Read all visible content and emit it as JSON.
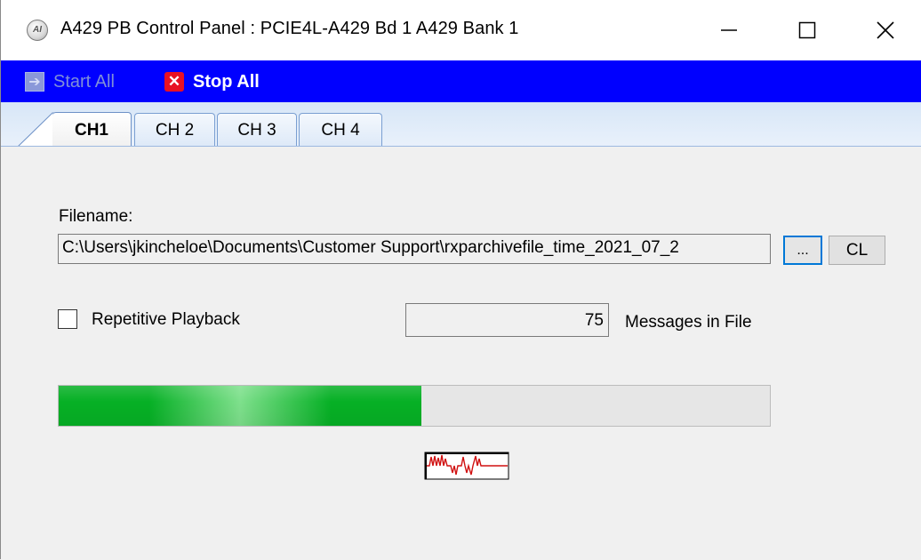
{
  "window": {
    "title": "A429 PB Control Panel : PCIE4L-A429 Bd 1 A429 Bank 1",
    "icon_text": "AI"
  },
  "toolbar": {
    "start_all_label": "Start All",
    "stop_all_label": "Stop All",
    "start_all_enabled": false,
    "background_color": "#0000ff"
  },
  "tabs": [
    {
      "label": "CH1",
      "active": true
    },
    {
      "label": "CH 2",
      "active": false
    },
    {
      "label": "CH 3",
      "active": false
    },
    {
      "label": "CH 4",
      "active": false
    }
  ],
  "main": {
    "filename_label": "Filename:",
    "filename_value": "C:\\Users\\jkincheloe\\Documents\\Customer Support\\rxparchivefile_time_2021_07_2",
    "browse_label": "...",
    "clear_label": "CL",
    "repetitive_playback_label": "Repetitive Playback",
    "repetitive_playback_checked": false,
    "message_count": "75",
    "messages_label": "Messages in File",
    "progress_fraction": 0.51,
    "progress_color": "#06b025",
    "signal_icon": "waveform-icon"
  }
}
